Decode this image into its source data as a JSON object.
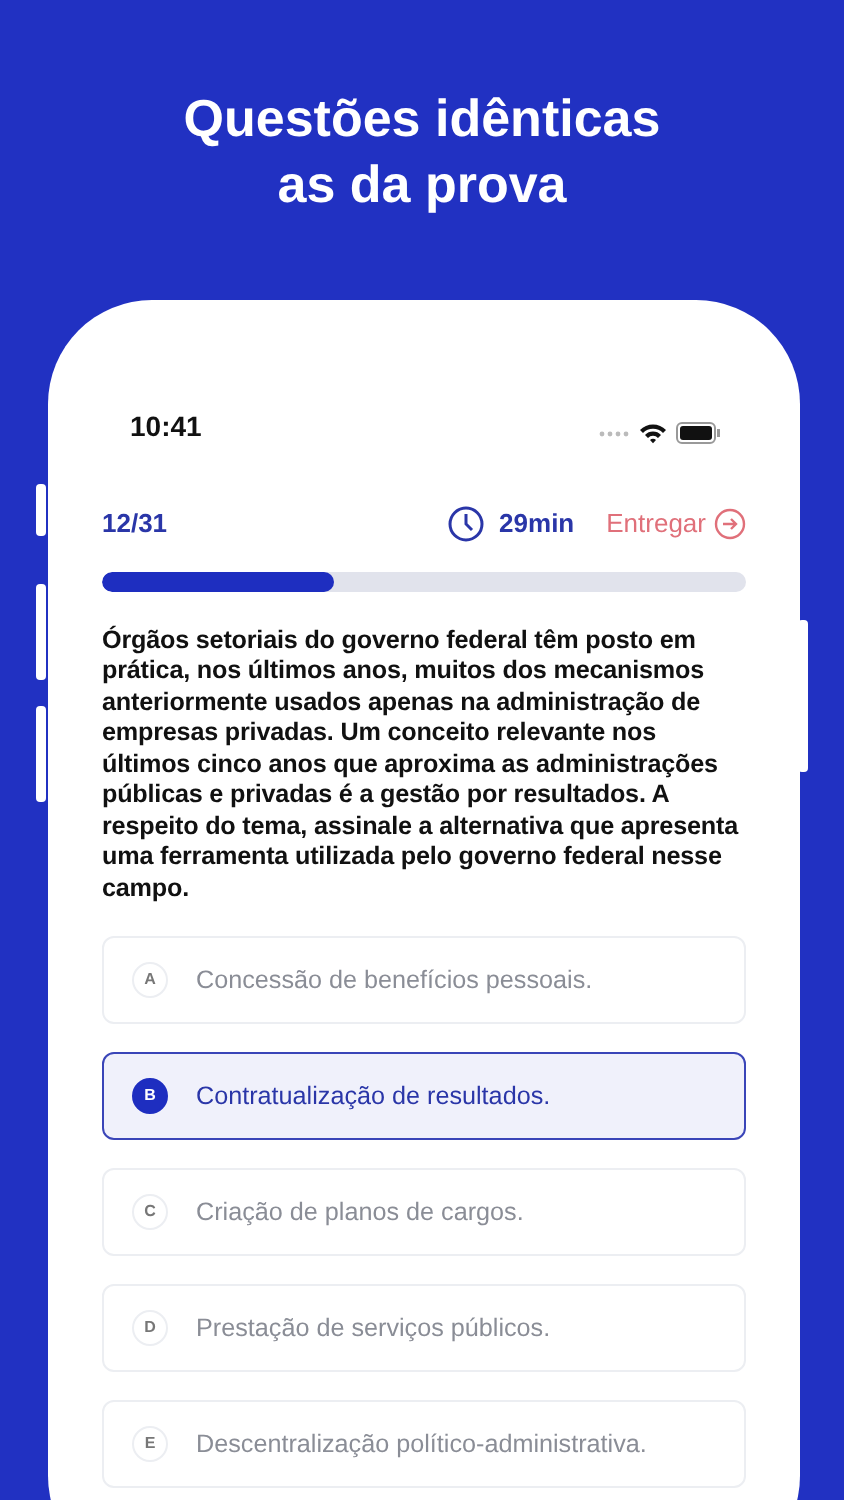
{
  "headline": [
    "Questões idênticas",
    "as da prova"
  ],
  "status_bar": {
    "time": "10:41"
  },
  "quiz_header": {
    "counter": "12/31",
    "timer": "29min",
    "submit": "Entregar"
  },
  "progress": {
    "level": 0.36
  },
  "question": "Órgãos setoriais do governo federal têm posto em prática, nos últimos anos, muitos dos mecanismos anteriormente usados apenas na administração de empresas privadas. Um conceito relevante nos últimos cinco anos que aproxima as administrações públicas e privadas é a gestão por resultados. A respeito do tema, assinale a alternativa que apresenta uma ferramenta utilizada pelo governo federal nesse campo.",
  "options": [
    {
      "letter": "A",
      "text": "Concessão de benefícios pessoais.",
      "selected": false
    },
    {
      "letter": "B",
      "text": "Contratualização de resultados.",
      "selected": true
    },
    {
      "letter": "C",
      "text": "Criação de planos de cargos.",
      "selected": false
    },
    {
      "letter": "D",
      "text": "Prestação de serviços públicos.",
      "selected": false
    },
    {
      "letter": "E",
      "text": "Descentralização político-administrativa.",
      "selected": false
    }
  ]
}
